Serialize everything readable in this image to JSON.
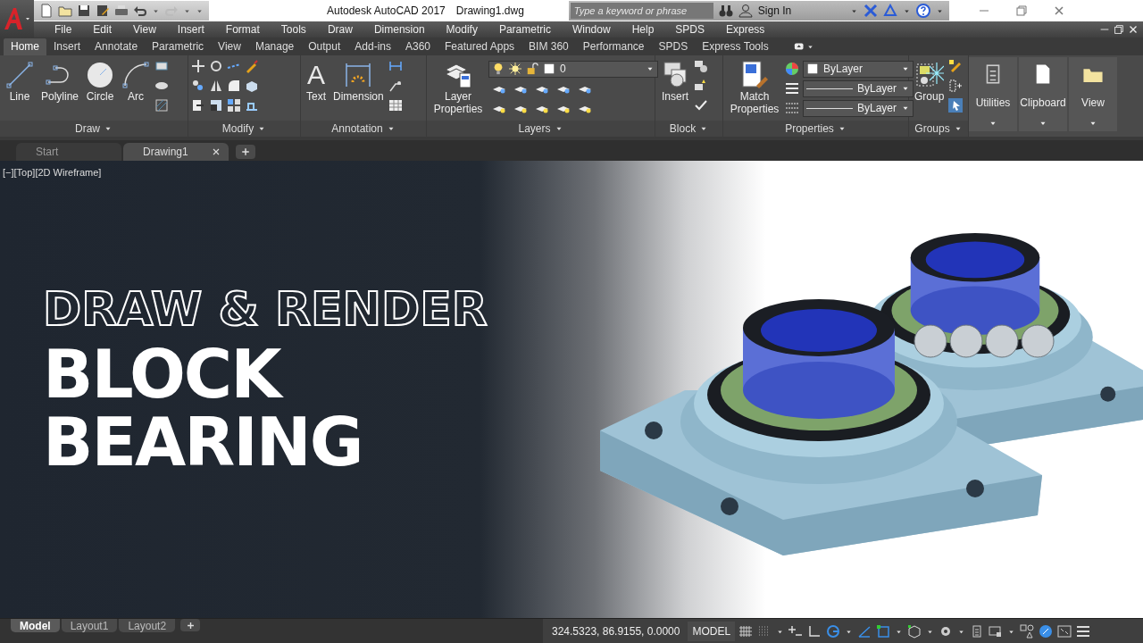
{
  "title_bar": {
    "title": "Autodesk AutoCAD 2017",
    "document": "Drawing1.dwg",
    "search": {
      "placeholder": "Type a keyword or phrase"
    },
    "sign_in": "Sign In"
  },
  "menu_bar": [
    "File",
    "Edit",
    "View",
    "Insert",
    "Format",
    "Tools",
    "Draw",
    "Dimension",
    "Modify",
    "Parametric",
    "Window",
    "Help",
    "SPDS",
    "Express"
  ],
  "ribbon_tabs": [
    {
      "label": "Home",
      "selected": true
    },
    {
      "label": "Insert",
      "selected": false
    },
    {
      "label": "Annotate",
      "selected": false
    },
    {
      "label": "Parametric",
      "selected": false
    },
    {
      "label": "View",
      "selected": false
    },
    {
      "label": "Manage",
      "selected": false
    },
    {
      "label": "Output",
      "selected": false
    },
    {
      "label": "Add-ins",
      "selected": false
    },
    {
      "label": "A360",
      "selected": false
    },
    {
      "label": "Featured Apps",
      "selected": false
    },
    {
      "label": "BIM 360",
      "selected": false
    },
    {
      "label": "Performance",
      "selected": false
    },
    {
      "label": "SPDS",
      "selected": false
    },
    {
      "label": "Express Tools",
      "selected": false
    }
  ],
  "ribbon_panels": [
    {
      "title": "Draw",
      "kind": "tools",
      "tools": [
        {
          "label": "Line",
          "kind": "line"
        },
        {
          "label": "Polyline",
          "kind": "polyline"
        },
        {
          "label": "Circle",
          "kind": "circle"
        },
        {
          "label": "Arc",
          "kind": "arc"
        }
      ]
    },
    {
      "title": "Modify",
      "kind": "tools"
    },
    {
      "title": "Annotation",
      "kind": "tools",
      "tools": [
        {
          "label": "Text",
          "kind": "text",
          "glyph": "A"
        },
        {
          "label": "Dimension",
          "kind": "dimension"
        }
      ]
    },
    {
      "title": "Layers",
      "kind": "layers",
      "tools": [
        {
          "label": "Layer Properties",
          "kind": "layers"
        }
      ],
      "layer": "0"
    },
    {
      "title": "Block",
      "kind": "tools",
      "tools": [
        {
          "label": "Insert",
          "kind": "insert"
        }
      ]
    },
    {
      "title": "Properties",
      "kind": "properties",
      "tools": [
        {
          "label": "Match Properties",
          "kind": "match"
        }
      ],
      "dropdowns": [
        "ByLayer",
        "ByLayer",
        "ByLayer"
      ]
    },
    {
      "title": "Groups",
      "kind": "tools",
      "tools": [
        {
          "label": "Group",
          "kind": "group"
        }
      ]
    },
    {
      "title": "Utilities",
      "kind": "collapsed"
    },
    {
      "title": "Clipboard",
      "kind": "collapsed"
    },
    {
      "title": "View",
      "kind": "collapsed"
    }
  ],
  "document_tabs": [
    {
      "label": "Start",
      "selected": false
    },
    {
      "label": "Drawing1",
      "selected": true
    }
  ],
  "viewport": {
    "label": "[−][Top][2D Wireframe]",
    "headline": [
      {
        "text": "DRAW & RENDER",
        "kind": "outline"
      },
      {
        "text": "BLOCK",
        "kind": "solid"
      },
      {
        "text": "BEARING",
        "kind": "solid"
      }
    ]
  },
  "layout_tabs": [
    {
      "label": "Model",
      "selected": true
    },
    {
      "label": "Layout1",
      "selected": false
    },
    {
      "label": "Layout2",
      "selected": false
    }
  ],
  "status_bar": {
    "coordinates": "324.5323, 86.9155, 0.0000",
    "space": "MODEL"
  }
}
